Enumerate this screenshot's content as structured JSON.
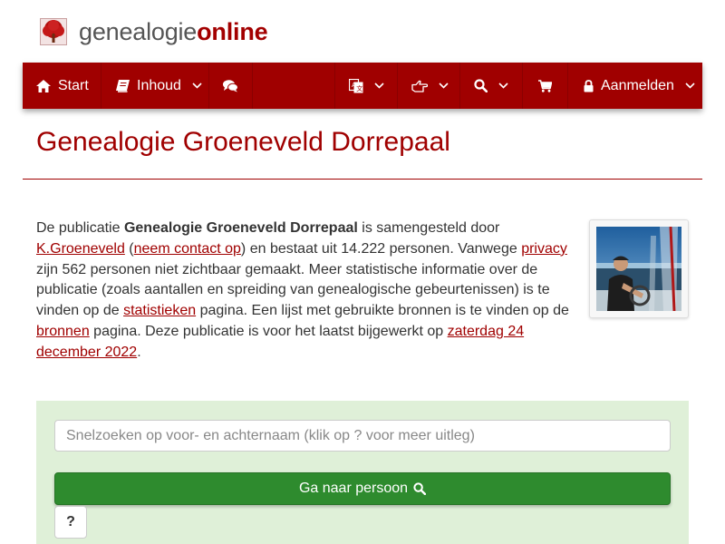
{
  "logo": {
    "word_plain": "genealogie",
    "word_bold": "online",
    "icon": "tree-icon"
  },
  "nav": {
    "start_label": "Start",
    "inhoud_label": "Inhoud",
    "login_label": "Aanmelden",
    "icons": {
      "start": "home-icon",
      "inhoud": "book-icon",
      "forum": "comments-icon",
      "language": "translate-icon",
      "share": "hand-point-icon",
      "search": "search-icon",
      "cart": "cart-icon",
      "login": "lock-icon",
      "dropdown": "chevron-down-icon"
    }
  },
  "page": {
    "title": "Genealogie Groeneveld Dorrepaal"
  },
  "intro": {
    "t1": "De publicatie ",
    "pub_name": "Genealogie Groeneveld Dorrepaal",
    "t2": " is samengesteld door ",
    "author_link": "K.Groeneveld",
    "t3": " (",
    "contact_link": "neem contact op",
    "t4": ") en bestaat uit 14.222 personen. Vanwege ",
    "privacy_link": "privacy",
    "t5": " zijn 562 personen niet zichtbaar gemaakt. Meer statistische informatie over de publicatie (zoals aantallen en spreiding van genealogische gebeurtenissen) is te vinden op de ",
    "stats_link": "statistieken",
    "t6": " pagina. Een lijst met gebruikte bronnen is te vinden op de ",
    "sources_link": "bronnen",
    "t7": " pagina. Deze publicatie is voor het laatst bijgewerkt op ",
    "date_link": "zaterdag 24 december 2022",
    "t8": "."
  },
  "search": {
    "placeholder": "Snelzoeken op voor- en achternaam (klik op ? voor meer uitleg)",
    "button_label": "Ga naar persoon",
    "help_label": "?"
  },
  "colors": {
    "brand": "#a00000",
    "nav_bg": "#a00000",
    "panel_bg": "#dff0d8",
    "button_green": "#2e8b2e"
  }
}
